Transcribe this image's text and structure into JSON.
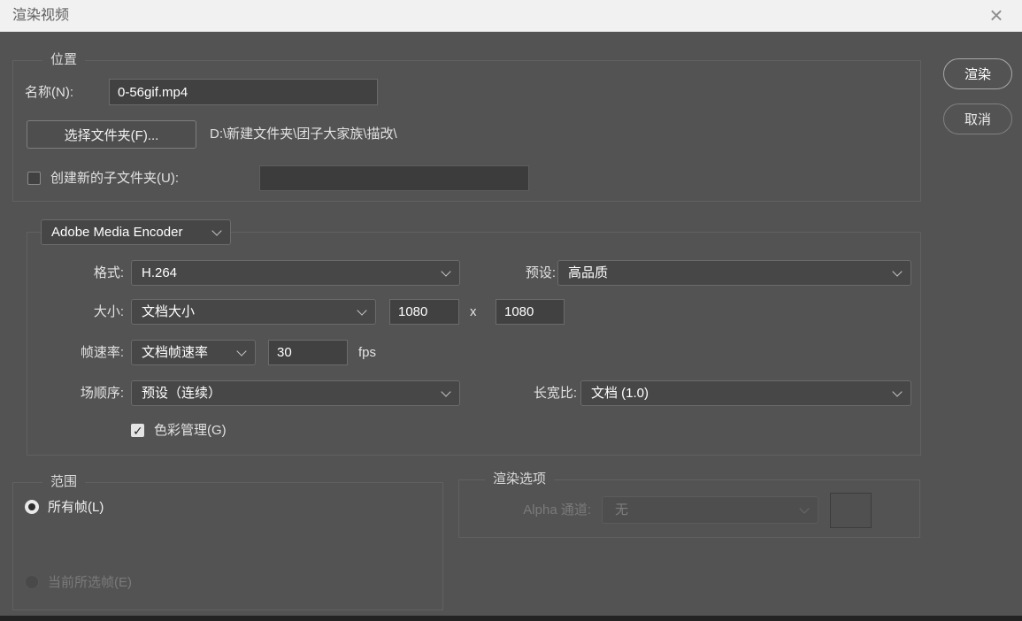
{
  "window": {
    "title": "渲染视频"
  },
  "actions": {
    "render": "渲染",
    "cancel": "取消"
  },
  "location": {
    "legend": "位置",
    "name_label": "名称(N):",
    "name_value": "0-56gif.mp4",
    "choose_folder_button": "选择文件夹(F)...",
    "folder_path": "D:\\新建文件夹\\团子大家族\\描改\\",
    "subfolder_label": "创建新的子文件夹(U):",
    "subfolder_checked": false,
    "subfolder_value": ""
  },
  "encoder": {
    "selector_value": "Adobe Media Encoder",
    "format_label": "格式:",
    "format_value": "H.264",
    "preset_label": "预设:",
    "preset_value": "高品质",
    "size_label": "大小:",
    "size_value": "文档大小",
    "size_width": "1080",
    "size_separator": "x",
    "size_height": "1080",
    "framerate_label": "帧速率:",
    "framerate_value": "文档帧速率",
    "framerate_fps": "30",
    "fps_unit": "fps",
    "field_order_label": "场顺序:",
    "field_order_value": "预设（连续）",
    "aspect_label": "长宽比:",
    "aspect_value": "文档 (1.0)",
    "color_manage_label": "色彩管理(G)",
    "color_manage_checked": true
  },
  "range": {
    "legend": "范围",
    "all_frames_label": "所有帧(L)",
    "current_frames_label": "当前所选帧(E)",
    "selected": "all_frames"
  },
  "render_options": {
    "legend": "渲染选项",
    "alpha_label": "Alpha 通道:",
    "alpha_value": "无",
    "enabled": false
  },
  "colors": {
    "dialog_bg": "#535353",
    "titlebar_bg": "#f1f1f1",
    "input_bg": "#414141",
    "default_button_border": "#a8a8a8"
  }
}
